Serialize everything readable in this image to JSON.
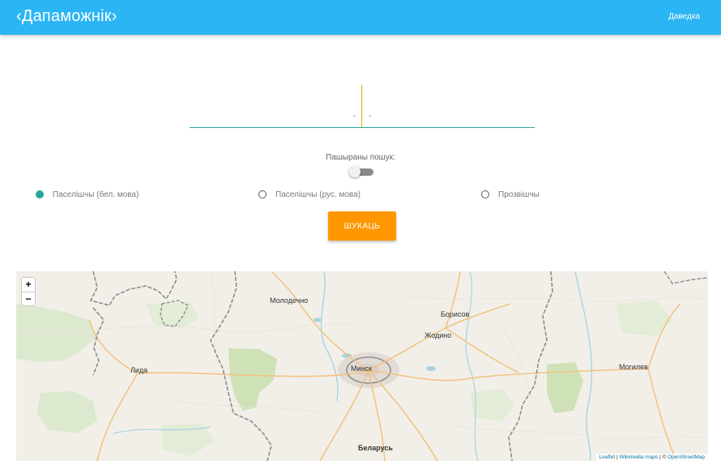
{
  "header": {
    "title": "‹Дапаможнік›",
    "help_link": "Даведка"
  },
  "search": {
    "value": "",
    "placeholder": ""
  },
  "advanced": {
    "label": "Пашыраны пошук:",
    "enabled": false
  },
  "options": [
    {
      "label": "Паселішчы (бел. мова)",
      "selected": true
    },
    {
      "label": "Паселішчы (рус. мова)",
      "selected": false
    },
    {
      "label": "Прозвішчы",
      "selected": false
    }
  ],
  "search_button": "ШУКАЦЬ",
  "colors": {
    "header": "#2bb5f4",
    "accent": "#26a69a",
    "button": "#ff9800",
    "caret": "#f2a600"
  },
  "map": {
    "zoom_in": "+",
    "zoom_out": "−",
    "places": [
      "Молодечно",
      "Борисов",
      "Жодино",
      "Лида",
      "Минск",
      "Могилев",
      "Беларусь"
    ],
    "attribution": {
      "leaflet": "Leaflet",
      "wikimedia": "Wikimedia maps",
      "osm_prefix": "© ",
      "osm": "OpenStreetMap"
    }
  }
}
